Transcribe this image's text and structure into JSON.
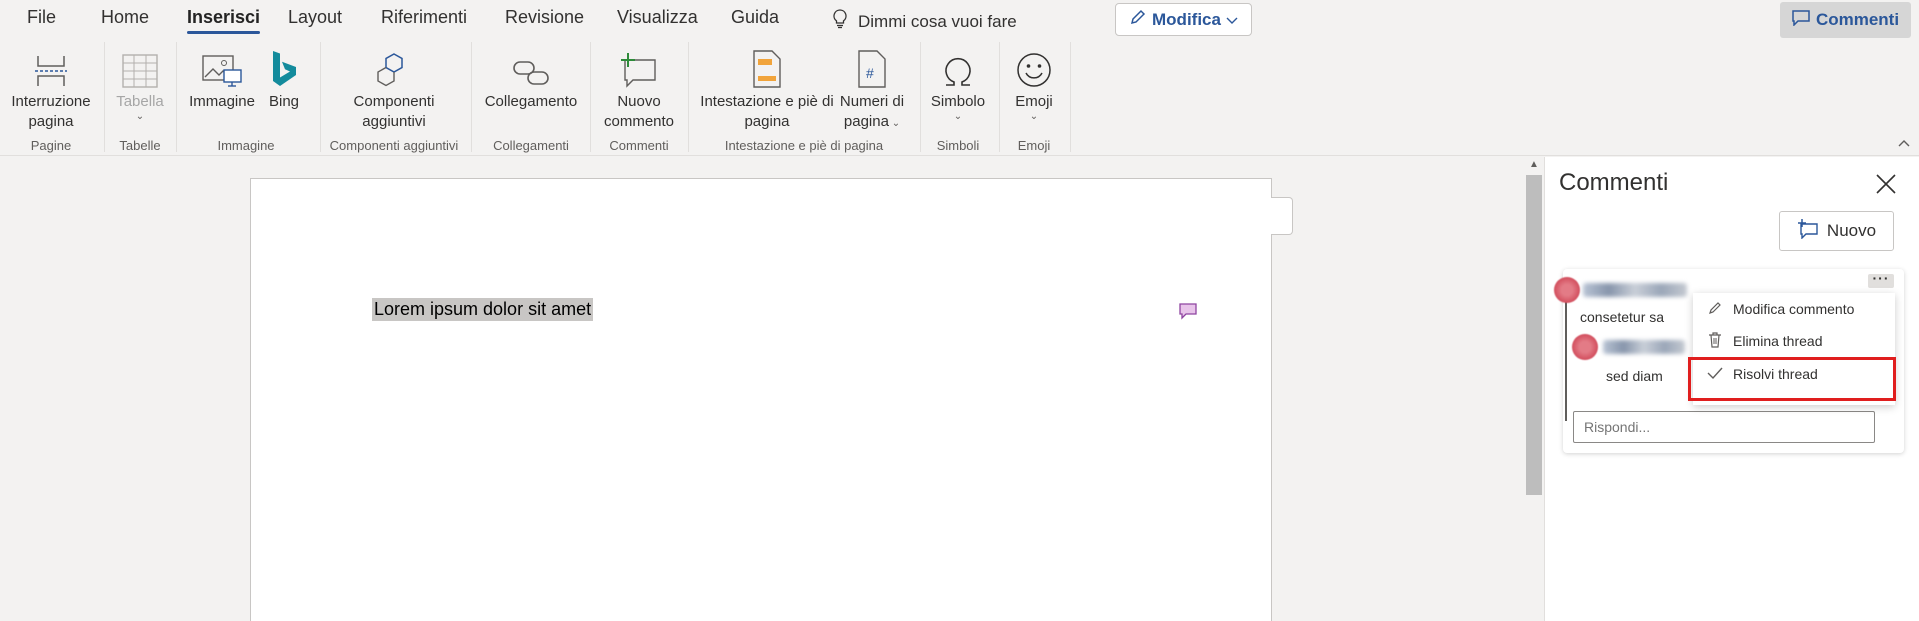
{
  "ribbon": {
    "tabs": [
      "File",
      "Home",
      "Inserisci",
      "Layout",
      "Riferimenti",
      "Revisione",
      "Visualizza",
      "Guida"
    ],
    "active_tab": "Inserisci",
    "tell_me": "Dimmi cosa vuoi fare",
    "modifica_label": "Modifica",
    "commenti_label": "Commenti",
    "commands": {
      "interruzione": [
        "Interruzione",
        "pagina"
      ],
      "tabella": "Tabella",
      "immagine": "Immagine",
      "bing": "Bing",
      "componenti": [
        "Componenti",
        "aggiuntivi"
      ],
      "collegamento": "Collegamento",
      "nuovo_commento": [
        "Nuovo",
        "commento"
      ],
      "intestazione": [
        "Intestazione e piè di",
        "pagina"
      ],
      "numeri": [
        "Numeri di",
        "pagina"
      ],
      "simbolo": "Simbolo",
      "emoji": "Emoji"
    },
    "groups": {
      "pagine": "Pagine",
      "tabelle": "Tabelle",
      "immagine": "Immagine",
      "componenti": "Componenti aggiuntivi",
      "collegamenti": "Collegamenti",
      "commenti": "Commenti",
      "intestazione": "Intestazione e piè di pagina",
      "simboli": "Simboli",
      "emoji": "Emoji"
    }
  },
  "document": {
    "text": "Lorem ipsum dolor sit amet"
  },
  "comments_pane": {
    "title": "Commenti",
    "new_label": "Nuovo",
    "thread": {
      "first_text": "consetetur sa",
      "reply_text": "sed diam",
      "reply_placeholder": "Rispondi..."
    },
    "menu": [
      {
        "label": "Modifica commento",
        "icon": "pencil-icon"
      },
      {
        "label": "Elimina thread",
        "icon": "trash-icon"
      },
      {
        "label": "Risolvi thread",
        "icon": "checkmark-icon"
      }
    ],
    "highlight_color": "#e01e1e"
  },
  "colors": {
    "accent": "#2b579a",
    "ribbon_bg": "#f3f2f1"
  }
}
